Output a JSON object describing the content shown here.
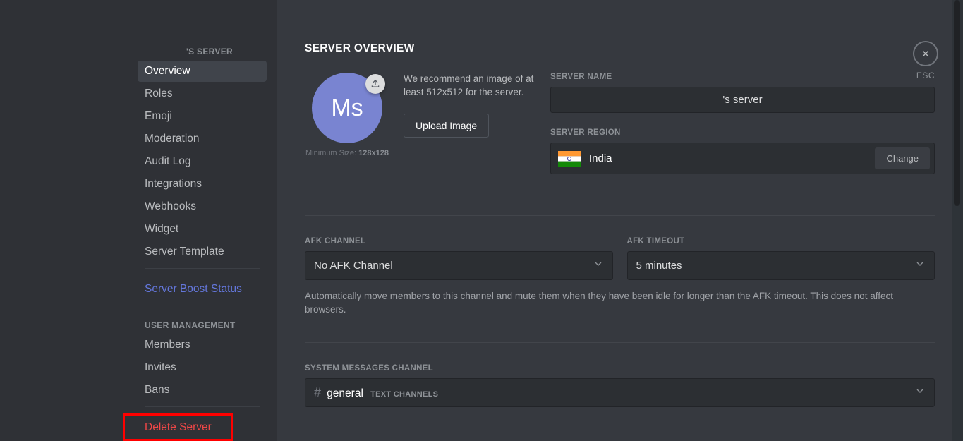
{
  "sidebar": {
    "server_header": "'S SERVER",
    "items": [
      {
        "label": "Overview",
        "selected": true
      },
      {
        "label": "Roles"
      },
      {
        "label": "Emoji"
      },
      {
        "label": "Moderation"
      },
      {
        "label": "Audit Log"
      },
      {
        "label": "Integrations"
      },
      {
        "label": "Webhooks"
      },
      {
        "label": "Widget"
      },
      {
        "label": "Server Template"
      }
    ],
    "boost_label": "Server Boost Status",
    "user_mgmt_header": "USER MANAGEMENT",
    "user_mgmt_items": [
      {
        "label": "Members"
      },
      {
        "label": "Invites"
      },
      {
        "label": "Bans"
      }
    ],
    "delete_label": "Delete Server"
  },
  "close": {
    "esc": "ESC"
  },
  "main": {
    "title": "SERVER OVERVIEW",
    "avatar_initials": "Ms",
    "min_size_prefix": "Minimum Size: ",
    "min_size_value": "128x128",
    "recommend_text": "We recommend an image of at least 512x512 for the server.",
    "upload_btn": "Upload Image",
    "server_name_label": "SERVER NAME",
    "server_name_value": "'s server",
    "server_region_label": "SERVER REGION",
    "region_name": "India",
    "change_btn": "Change",
    "afk_channel_label": "AFK CHANNEL",
    "afk_channel_value": "No AFK Channel",
    "afk_timeout_label": "AFK TIMEOUT",
    "afk_timeout_value": "5 minutes",
    "afk_help": "Automatically move members to this channel and mute them when they have been idle for longer than the AFK timeout. This does not affect browsers.",
    "sys_msg_label": "SYSTEM MESSAGES CHANNEL",
    "sys_channel_name": "general",
    "sys_channel_category": "TEXT CHANNELS"
  }
}
